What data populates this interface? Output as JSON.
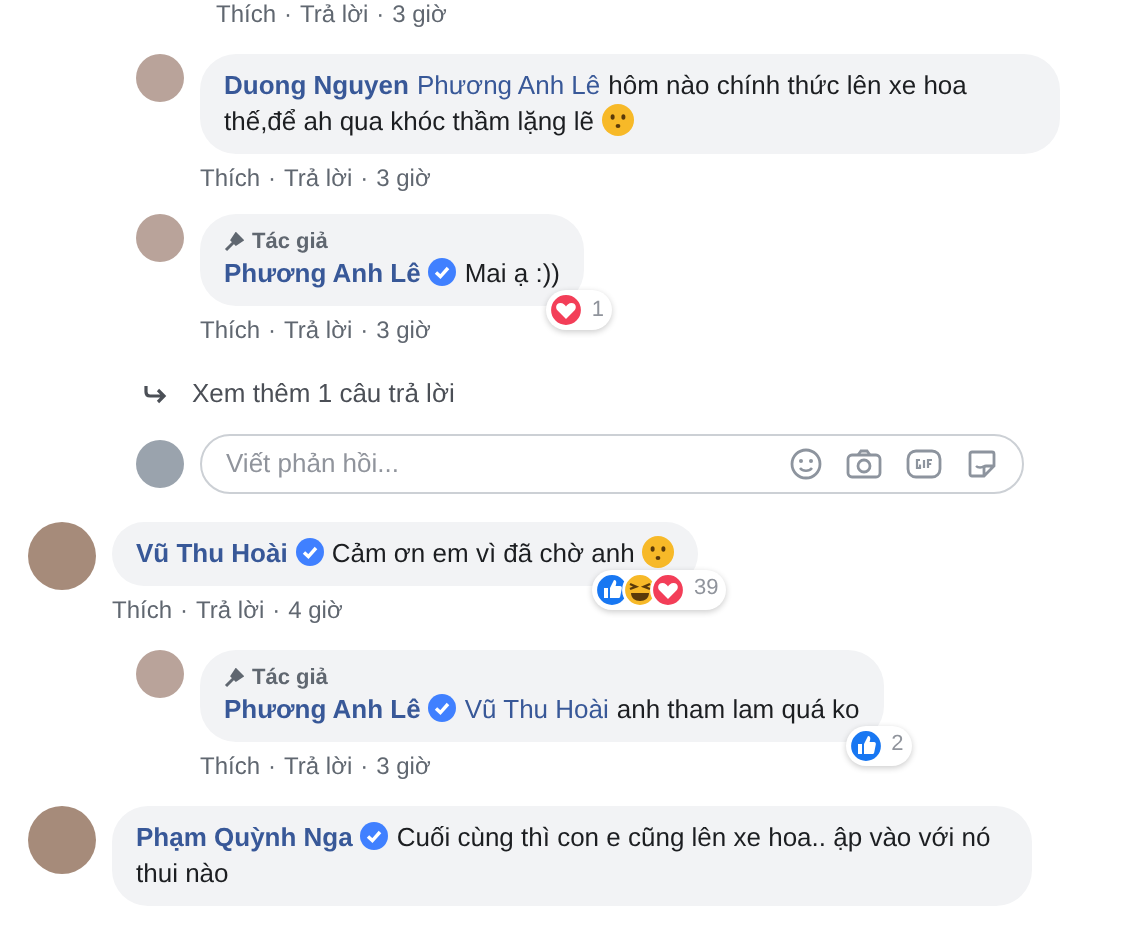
{
  "separator": "·",
  "earlier_thread": {
    "actions": {
      "like": "Thích",
      "reply": "Trả lời",
      "time": "3 giờ"
    },
    "replies": [
      {
        "author": "Duong Nguyen",
        "verified": false,
        "mention": "Phương Anh Lê",
        "text": "hôm nào chính thức lên xe hoa thế,để ah qua khóc thầm lặng lẽ",
        "emoji": true,
        "actions": {
          "like": "Thích",
          "reply": "Trả lời",
          "time": "3 giờ"
        }
      },
      {
        "author": "Phương Anh Lê",
        "author_badge": "Tác giả",
        "verified": true,
        "text": "Mai ạ :))",
        "emoji": false,
        "reactions": {
          "items": [
            {
              "kind": "love"
            }
          ],
          "count": "1"
        },
        "actions": {
          "like": "Thích",
          "reply": "Trả lời",
          "time": "3 giờ"
        }
      }
    ],
    "more_replies": "Xem thêm 1 câu trả lời",
    "reply_box": {
      "placeholder": "Viết phản hồi..."
    }
  },
  "comments": [
    {
      "author": "Vũ Thu Hoài",
      "verified": true,
      "text": "Cảm ơn em vì đã chờ anh",
      "emoji": true,
      "reactions": {
        "items": [
          {
            "kind": "like"
          },
          {
            "kind": "haha"
          },
          {
            "kind": "love"
          }
        ],
        "count": "39"
      },
      "actions": {
        "like": "Thích",
        "reply": "Trả lời",
        "time": "4 giờ"
      },
      "replies": [
        {
          "author": "Phương Anh Lê",
          "author_badge": "Tác giả",
          "verified": true,
          "mention": "Vũ Thu Hoài",
          "text": "anh tham lam quá ko",
          "emoji": false,
          "reactions": {
            "items": [
              {
                "kind": "like"
              }
            ],
            "count": "2"
          },
          "actions": {
            "like": "Thích",
            "reply": "Trả lời",
            "time": "3 giờ"
          }
        }
      ]
    },
    {
      "author": "Phạm Quỳnh Nga",
      "verified": true,
      "text": "Cuối cùng thì con e cũng lên xe hoa.. ập vào với nó thui nào",
      "emoji": false
    }
  ]
}
